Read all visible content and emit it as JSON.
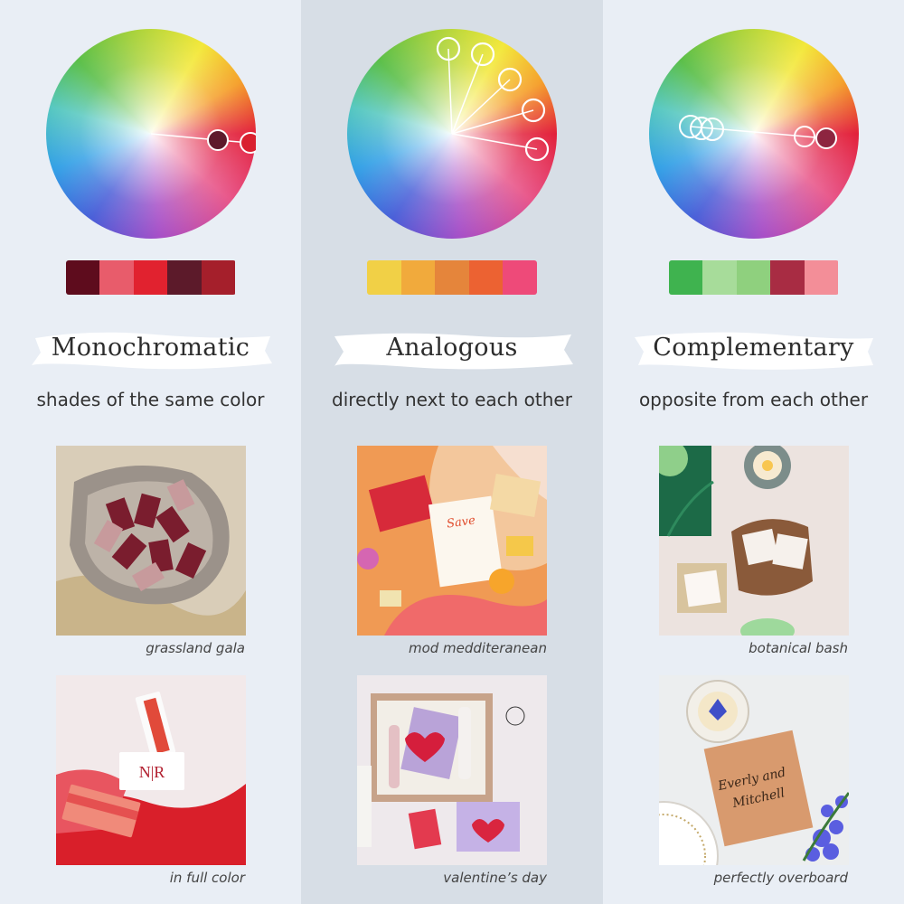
{
  "columns": [
    {
      "title": "Monochromatic",
      "subtitle": "shades of the same color",
      "swatches": [
        "#5e0c1d",
        "#e85c6b",
        "#e1222f",
        "#5c1a2a",
        "#a51f2b"
      ],
      "photos": [
        {
          "caption": "grassland gala"
        },
        {
          "caption": "in full color"
        }
      ]
    },
    {
      "title": "Analogous",
      "subtitle": "directly next to each other",
      "swatches": [
        "#f1d046",
        "#f1aa3c",
        "#e5853b",
        "#ec6232",
        "#ee4a79"
      ],
      "photos": [
        {
          "caption": "mod medditeranean"
        },
        {
          "caption": "valentine’s day"
        }
      ]
    },
    {
      "title": "Complementary",
      "subtitle": "opposite from each other",
      "swatches": [
        "#3fb34f",
        "#a7dc9a",
        "#8fd07e",
        "#a82c43",
        "#f38e98"
      ],
      "photos": [
        {
          "caption": "botanical bash"
        },
        {
          "caption": "perfectly overboard"
        }
      ]
    }
  ]
}
